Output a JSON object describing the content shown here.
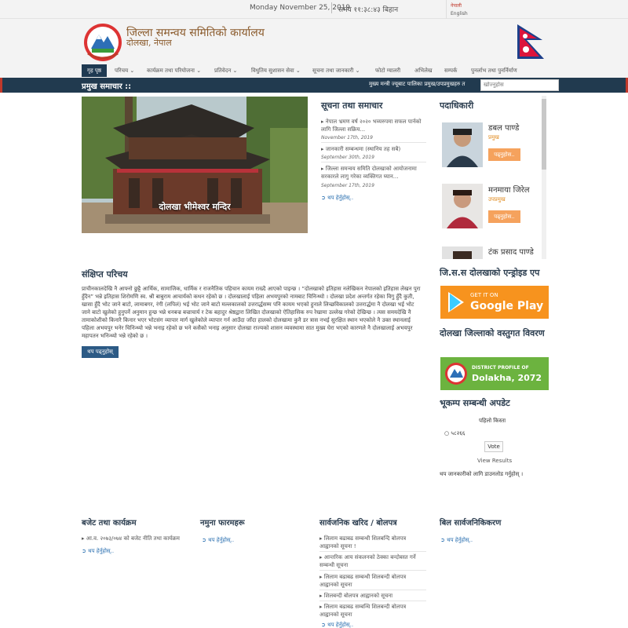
{
  "topbar": {
    "date": "Monday November 25, 2019",
    "time": "समय ११:३८:४३ बिहान",
    "lang_nepali": "नेपाली",
    "lang_english": "English"
  },
  "header": {
    "title": "जिल्ला समन्वय समितिको कार्यालय",
    "subtitle": "दोलखा, नेपाल"
  },
  "nav": {
    "items": [
      "गृह पृष्ठ",
      "परिचय",
      "कार्यक्रम तथा परियोजना",
      "प्रतिवेदन",
      "विधुतिय सुशासन सेवा",
      "सूचना तथा जानकारी",
      "फोटो ग्यालरी",
      "अभिलेख",
      "सम्पर्क",
      "पुनर्लाभ तथा पुनर्निर्माण"
    ]
  },
  "news_strip": {
    "label": "प्रमुख समाचार ::",
    "ticker": "मुख्य मन्त्री ज्यूबाट पालिका प्रमुख/उपप्रमुखहरु त",
    "search_placeholder": "खोज्नुहोस"
  },
  "hero": {
    "caption": "दोलखा भीमेश्वर मन्दिर"
  },
  "notices": {
    "title": "सूचना तथा समाचार",
    "items": [
      {
        "text": "नेपाल भ्रमण वर्ष २०२० भव्यरुपमा सफल पार्नको लागि जिल्ला सक्रिय...",
        "date": "November 17th, 2019"
      },
      {
        "text": "जानकारी सम्बन्धमा (स्थानिय तह सबै)",
        "date": "September 30th, 2019"
      },
      {
        "text": "जिल्ला समन्वय समिति दोलखाको आयोजनामा सरकारले लागु गरेका व्यक्तिगत घ्यान...",
        "date": "September 17th, 2019"
      }
    ],
    "more": "थप हेर्नुहोस्.."
  },
  "officials": {
    "title": "पदाधिकारी",
    "people": [
      {
        "name": "डबल पाण्डे",
        "post": "प्रमुख",
        "button": "पढ्नुहोस.."
      },
      {
        "name": "मनमाया जिरेल",
        "post": "उपप्रमुख",
        "button": "पढ्नुहोस.."
      },
      {
        "name": "टंक प्रसाद पाण्डे",
        "post": "",
        "button": ""
      }
    ]
  },
  "about": {
    "title": "संक्षिप्त परिचय",
    "text": "प्राचीनकालदेखि नै आफ्नो छुट्टै आर्थिक, सामाजिक, धार्मिक र राजनैतिक पहिचान कायम राख्दै आएको पाइन्छ । “दोलखाको इतिहास नलेखिकन नेपालको इतिहास लेखन पुरा हुँदैन” भन्ने इतिहास शिरोमणि स्व. श्री बाबुराम आचार्यको कथन रहेको छ । दोलखालाई पहिला अभयपुरको नामबाट चिनिन्थ्यो । दोलखा प्रदेश अन्तर्गत रहेका विगु हुँदै कुती, खासा हुँदै भोट जाने बाटो, लामाबगर, रंगी (लपिलं) भई भोट जाने बाटो मल्लकालको उत्तरार्द्धसम्म पनि कायम भएको हुनाले लिच्छविकालको उत्तरार्द्धमा नै दोलखा भई भोट जाने बाटो खुलेको हुनुपर्ने अनुमान हुन्छ भन्ने धनबज्र बज्राचार्य र टेक बहादुर श्रेष्ठद्वारा लिखित दोलखाको ऐतिहासिक रुप रेखामा उल्लेख गरेको देखिन्छ । त्यस समयदेखि नै तामाकोशीको किनारै किनार भएर भोटसंग व्यापार मार्ग खुलेकोले व्यापार गर्न आउँदा जाँदा हालको दोलखामा कुनै डर त्रास नभई सुरक्षित स्थान भएकोले नै उक्त स्थानलाई पहिला अभयपुर भनेर चिनिन्थ्यो भन्ने भनाइ रहेको छ भने कसैको भनाइ अनुसार दोलखा राज्यको शासन व्यवस्थामा सात मुख्य घेरा भएको कारणले नै दोलखालाई अभयपुर महापतन भनिन्थ्यो भन्ने रहेको छ ।",
    "button": "थप पढ्नुहोस्"
  },
  "sidebar": {
    "app_title": "जि.स.स दोलखाको एन्ड्रोइड एप",
    "gplay_small": "GET IT ON",
    "gplay_big": "Google Play",
    "profile_title": "दोलखा जिल्लाको वस्तुगत विवरण",
    "profile_small": "DISTRICT PROFILE OF",
    "profile_big": "Dolakha, 2072",
    "quake_title": "भूकम्प सम्बन्धी अपडेट",
    "poll_question": "पहिलो किस्ता",
    "poll_option": "५८२६६",
    "vote": "Vote",
    "results": "View Results",
    "download": "थप जानकारीको लागि डाउनलोड गर्नुहोस् ।"
  },
  "footer": {
    "budget": {
      "title": "बजेट तथा कार्यक्रम",
      "items": [
        "आ.व. २०७३/०७४ को बजेट नीति तथा कार्यक्रम"
      ],
      "more": "थप हेर्नुहोस्.."
    },
    "forms": {
      "title": "नमुना फारमहरू",
      "more": "थप हेर्नुहोस्.."
    },
    "procurement": {
      "title": "सार्वजनिक खरिद / बोलपत्र",
      "items": [
        "लिलाम बढाबढ सम्बन्धी शिलबन्दि बोलपत्र आह्वानको सूचना !",
        "आन्तरिक आय संकलनको ठेक्का बन्दोबस्त गर्ने सम्बन्धी सूचना",
        "लिलाम बढाबढ सम्बन्धी शिलबन्दी बोलपत्र आह्वानको सूचना",
        "शिलबन्दी बोलपत्र आह्वानको सूचना",
        "लिलाम बढाबढ सम्बन्धि शिलबन्दी बोलपत्र आह्वानको सूचना"
      ],
      "more": "थप हेर्नुहोस्.."
    },
    "bills": {
      "title": "बिल सार्वजनिकिकरण",
      "more": "थप हेर्नुहोस्.."
    }
  },
  "colors": {
    "navy": "#213a4f",
    "accent_red": "#c0392b",
    "orange": "#f5a25d",
    "link_blue": "#2a6fb0"
  }
}
